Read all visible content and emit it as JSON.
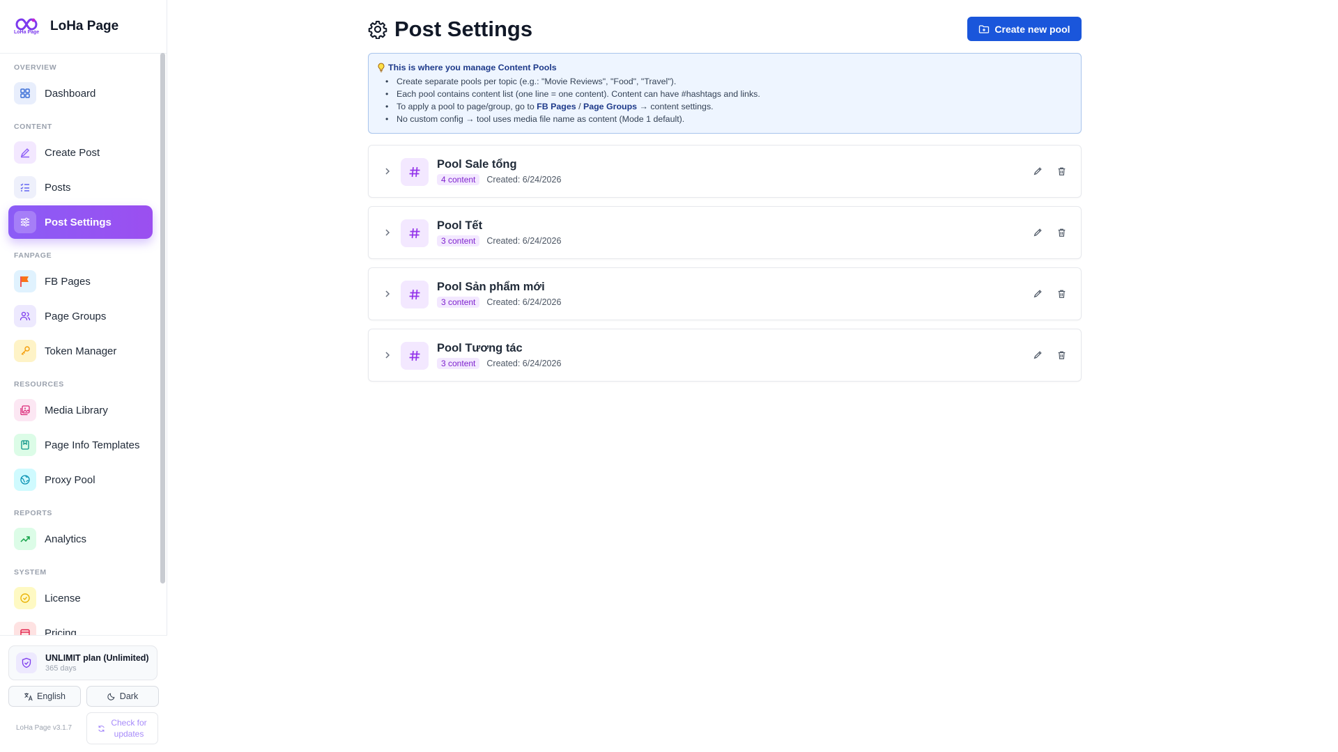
{
  "app": {
    "name": "LoHa Page",
    "logo_text": "LoHa Page"
  },
  "sidebar": {
    "sections": [
      {
        "label": "OVERVIEW"
      },
      {
        "label": "CONTENT"
      },
      {
        "label": "FANPAGE"
      },
      {
        "label": "RESOURCES"
      },
      {
        "label": "REPORTS"
      },
      {
        "label": "SYSTEM"
      }
    ],
    "items": [
      {
        "label": "Dashboard",
        "icon": "dashboard-icon"
      },
      {
        "label": "Create Post",
        "icon": "pencil-icon"
      },
      {
        "label": "Posts",
        "icon": "list-icon"
      },
      {
        "label": "Post Settings",
        "icon": "sliders-icon",
        "active": true
      },
      {
        "label": "FB Pages",
        "icon": "flag-icon"
      },
      {
        "label": "Page Groups",
        "icon": "users-icon"
      },
      {
        "label": "Token Manager",
        "icon": "key-icon"
      },
      {
        "label": "Media Library",
        "icon": "images-icon"
      },
      {
        "label": "Page Info Templates",
        "icon": "bookmark-icon"
      },
      {
        "label": "Proxy Pool",
        "icon": "globe-icon"
      },
      {
        "label": "Analytics",
        "icon": "trend-up-icon"
      },
      {
        "label": "License",
        "icon": "check-circle-icon"
      },
      {
        "label": "Pricing",
        "icon": "card-icon"
      }
    ],
    "plan": {
      "title": "UNLIMIT plan (Unlimited)",
      "days": "365 days"
    },
    "language_label": "English",
    "theme_label": "Dark",
    "version": "LoHa Page v3.1.7",
    "update_label_1": "Check for",
    "update_label_2": "updates"
  },
  "main": {
    "title": "Post Settings",
    "create_button": "Create new pool",
    "info": {
      "heading": "This is where you manage Content Pools",
      "bullets": {
        "b1": "Create separate pools per topic (e.g.: \"Movie Reviews\", \"Food\", \"Travel\").",
        "b2": "Each pool contains content list (one line = one content). Content can have #hashtags and links.",
        "b3_pre": "To apply a pool to page/group, go to ",
        "b3_link1": "FB Pages",
        "b3_sep": " / ",
        "b3_link2": "Page Groups",
        "b3_post": " → content settings.",
        "b4": "No custom config → tool uses media file name as content (Mode 1 default)."
      }
    },
    "pools": [
      {
        "name": "Pool Sale tổng",
        "count": "4 content",
        "created": "Created: 6/24/2026"
      },
      {
        "name": "Pool Tết",
        "count": "3 content",
        "created": "Created: 6/24/2026"
      },
      {
        "name": "Pool Sản phẩm mới",
        "count": "3 content",
        "created": "Created: 6/24/2026"
      },
      {
        "name": "Pool Tương tác",
        "count": "3 content",
        "created": "Created: 6/24/2026"
      }
    ]
  },
  "colors": {
    "accent": "#8b5cf6",
    "primary_button": "#1a56db",
    "info_bg": "#eef5ff",
    "badge_bg": "#f3e8ff",
    "badge_text": "#7e22ce"
  }
}
